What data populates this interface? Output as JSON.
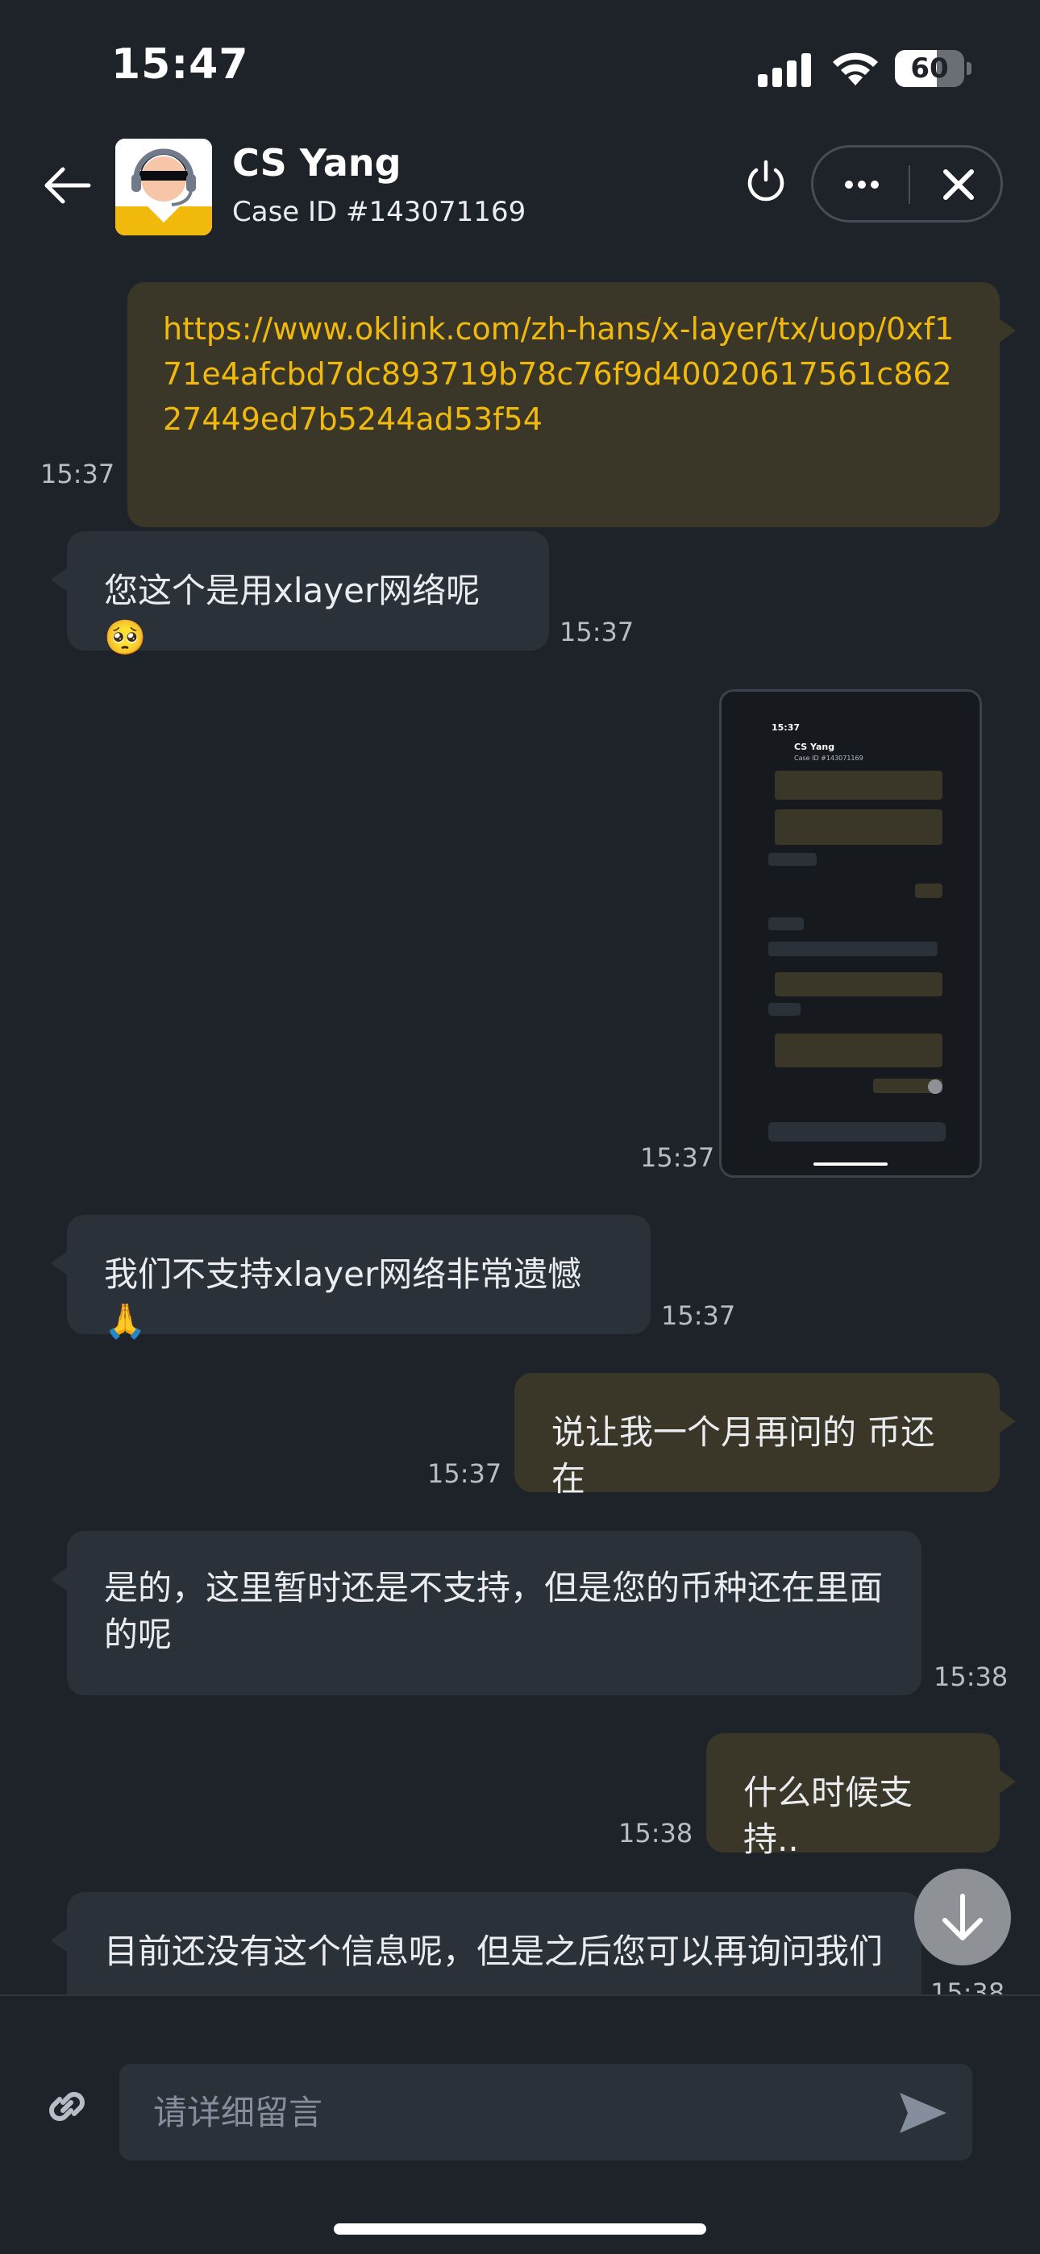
{
  "status_bar": {
    "time": "15:47",
    "battery": "60",
    "battery_level": 0.6
  },
  "header": {
    "agent_name": "CS Yang",
    "case_id": "Case ID #143071169",
    "icons": [
      "back-arrow-icon",
      "agent-avatar",
      "power-icon",
      "more-icon",
      "close-icon"
    ]
  },
  "messages": [
    {
      "dir": "out",
      "type": "link",
      "text": "https://www.oklink.com/zh-hans/x-layer/tx/uop/0xf171e4afcbd7dc893719b78c76f9d40020617561c86227449ed7b5244ad53f54",
      "time": "15:37"
    },
    {
      "dir": "in",
      "type": "text",
      "text": "您这个是用xlayer网络呢🥺",
      "time": "15:37"
    },
    {
      "dir": "out",
      "type": "image",
      "time": "15:37"
    },
    {
      "dir": "in",
      "type": "text",
      "text": "我们不支持xlayer网络非常遗憾🙏",
      "time": "15:37"
    },
    {
      "dir": "out",
      "type": "text",
      "text": "说让我一个月再问的 币还在",
      "time": "15:37"
    },
    {
      "dir": "in",
      "type": "text",
      "text": "是的，这里暂时还是不支持，但是您的币种还在里面的呢",
      "time": "15:38"
    },
    {
      "dir": "out",
      "type": "text",
      "text": "什么时候支持..",
      "time": "15:38"
    },
    {
      "dir": "in",
      "type": "text",
      "text": "目前还没有这个信息呢，但是之后您可以再询问我们",
      "time": "15:38"
    }
  ],
  "screenshot_preview": {
    "time": "15:37",
    "name": "CS Yang",
    "case_id": "Case ID #143071169"
  },
  "input": {
    "placeholder": "请详细留言"
  },
  "colors": {
    "background": "#1e2329",
    "incoming_bubble": "#2b3139",
    "outgoing_bubble": "#3a3728",
    "link": "#f0b90b",
    "timestamp": "#b7bdc6"
  }
}
